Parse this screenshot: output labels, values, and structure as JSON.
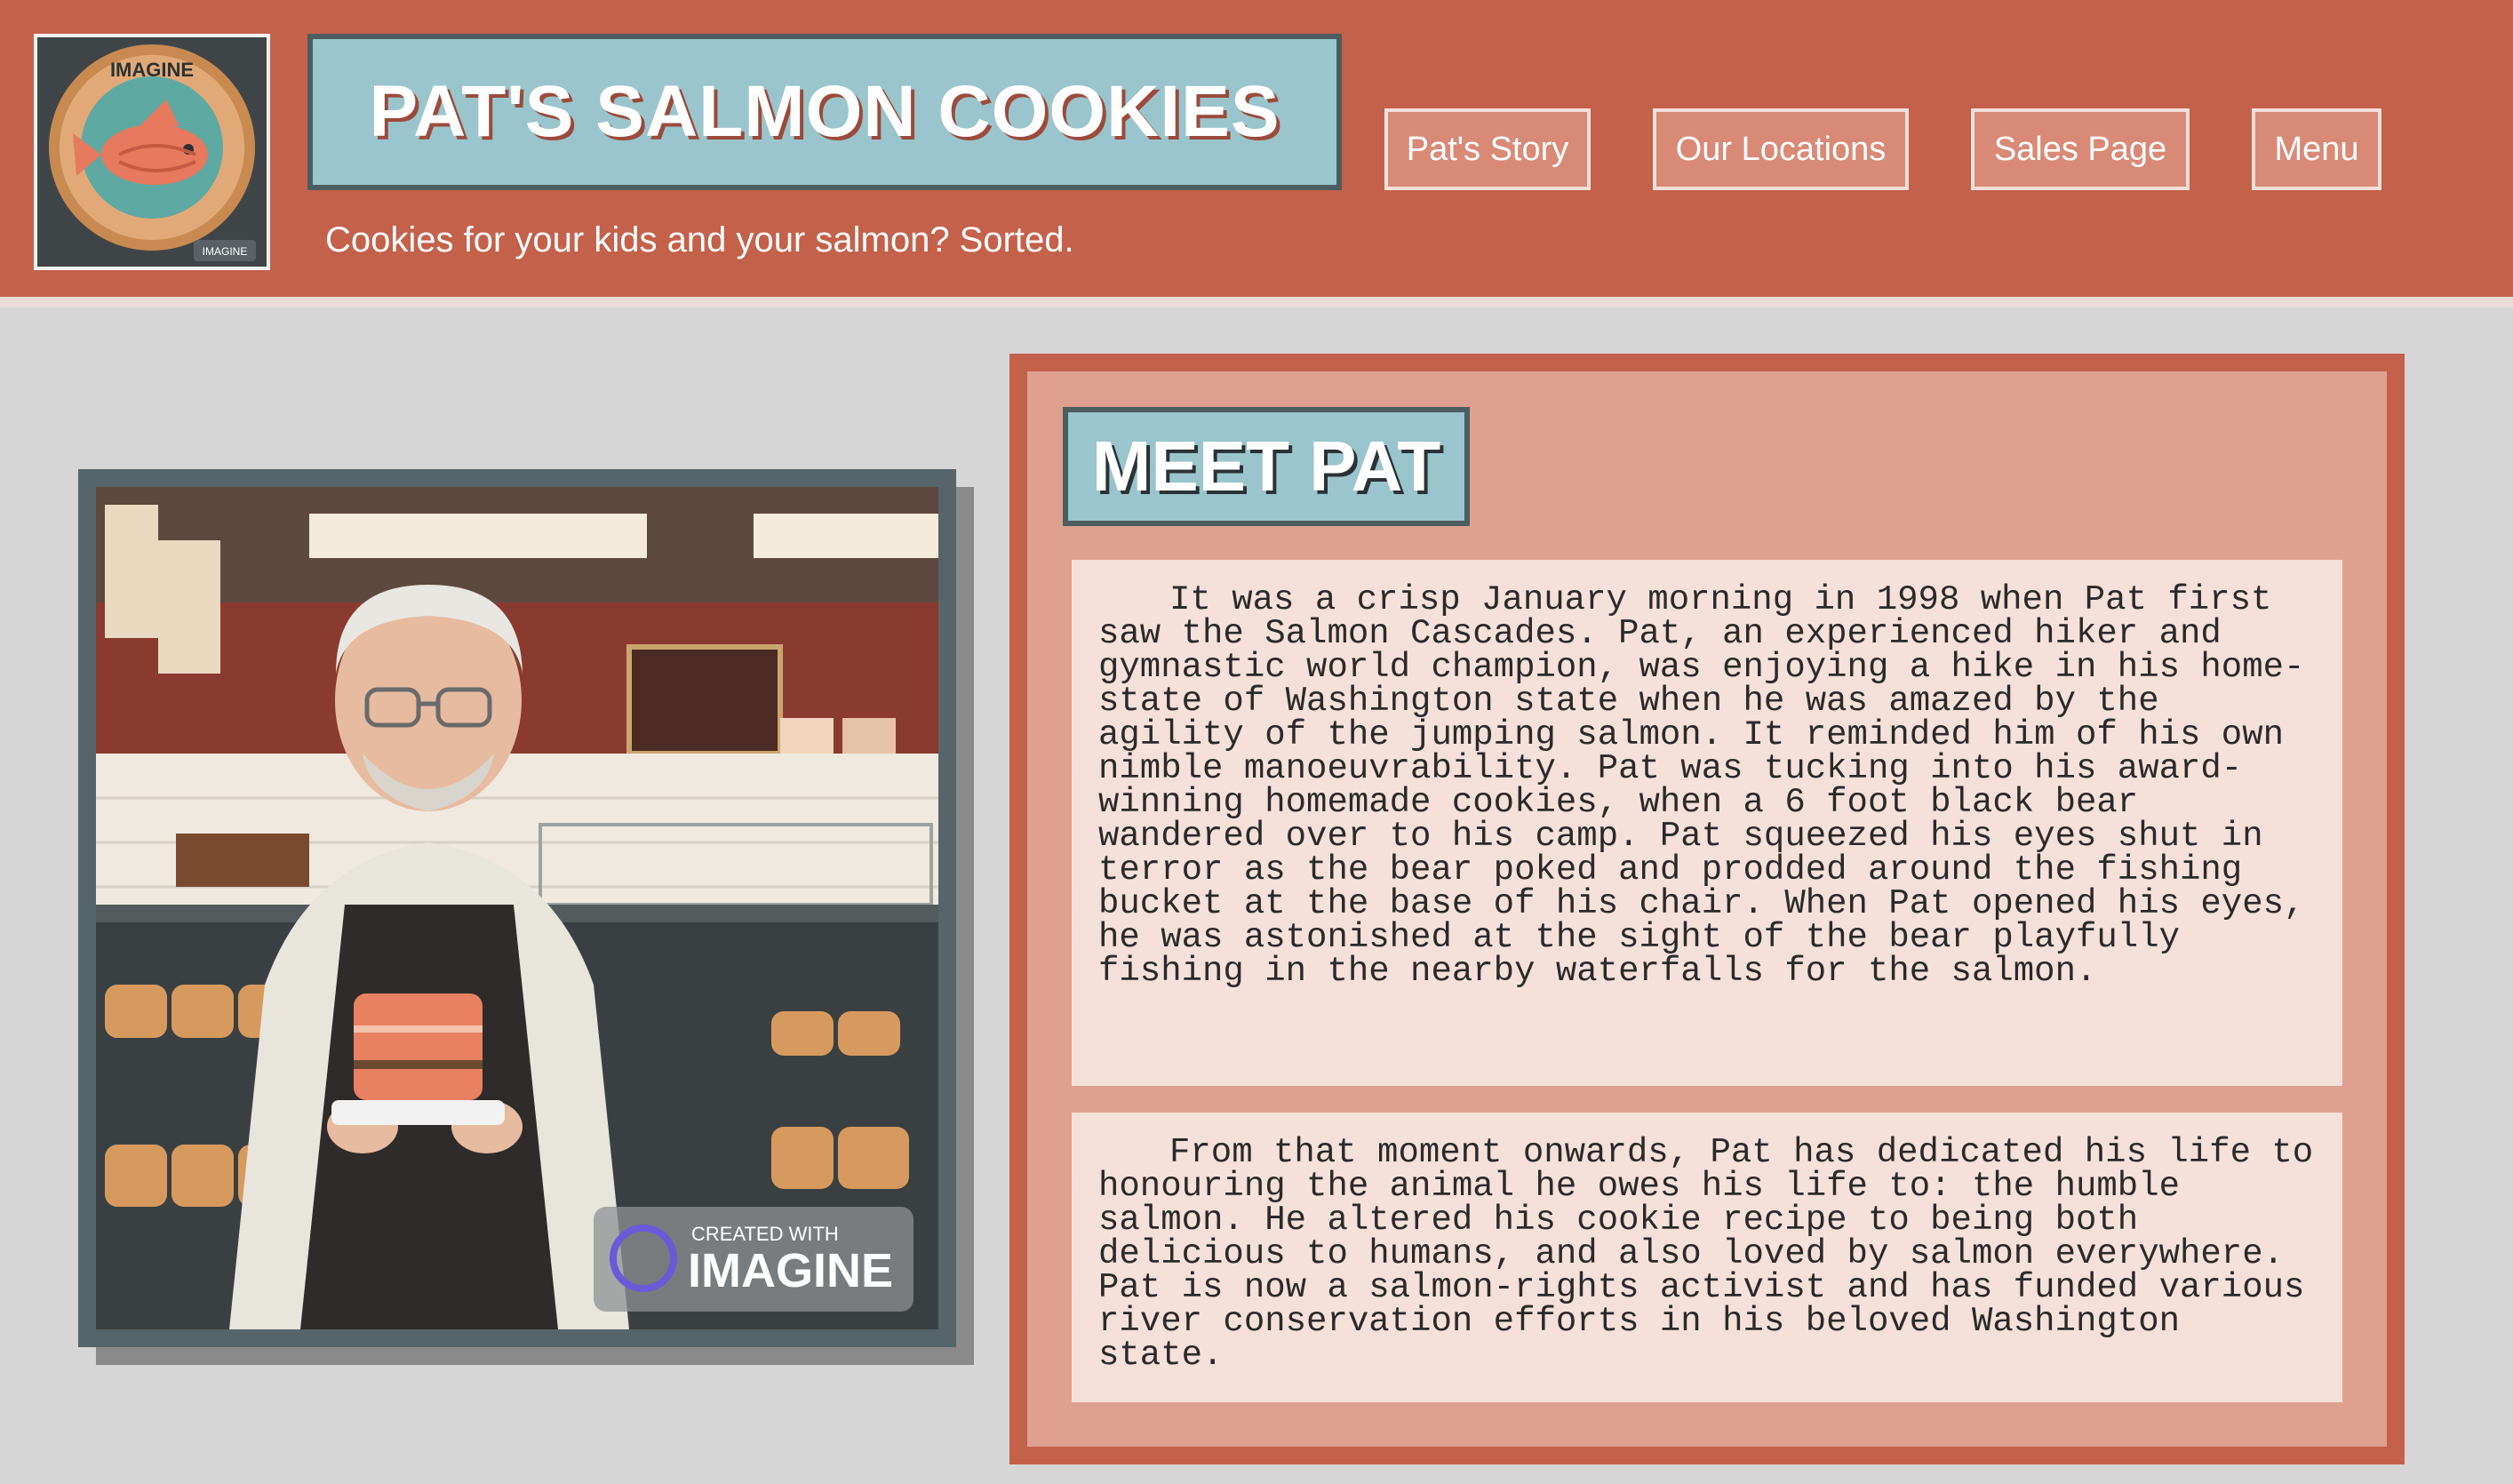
{
  "header": {
    "title": "PAT'S SALMON COOKIES",
    "tagline": "Cookies for your kids and your salmon? Sorted.",
    "logo": {
      "icon": "salmon-cookie-logo",
      "watermark": "IMAGINE"
    }
  },
  "nav": {
    "items": [
      {
        "label": "Pat's Story"
      },
      {
        "label": "Our Locations"
      },
      {
        "label": "Sales Page"
      },
      {
        "label": "Menu"
      }
    ]
  },
  "portrait": {
    "description_icon": "baker-portrait",
    "watermark_small": "CREATED WITH",
    "watermark_large": "IMAGINE"
  },
  "story": {
    "heading": "MEET PAT",
    "paragraphs": [
      "It was a crisp January morning in 1998 when Pat first saw the Salmon Cascades. Pat, an experienced hiker and gymnastic world champion, was enjoying a hike in his home-state of Washington state when he was amazed by the agility of the jumping salmon. It reminded him of his own nimble manoeuvrability. Pat was tucking into his award-winning homemade cookies, when a 6 foot black bear wandered over to his camp. Pat squeezed his eyes shut in terror as the bear poked and prodded around the fishing bucket at the base of his chair. When Pat opened his eyes, he was astonished at the sight of the bear playfully fishing in the nearby waterfalls for the salmon.",
      "From that moment onwards, Pat has dedicated his life to honouring the animal he owes his life to: the humble salmon. He altered his cookie recipe to being both delicious to humans, and also loved by salmon everywhere. Pat is now a salmon-rights activist and has funded various river conservation efforts in his beloved Washington state."
    ]
  },
  "colors": {
    "brand": "#c4614a",
    "title_bg": "#9ac5cc",
    "panel_bg": "#dea190",
    "paragraph_bg": "#f5e0da",
    "page_bg": "#d6d6d6"
  }
}
